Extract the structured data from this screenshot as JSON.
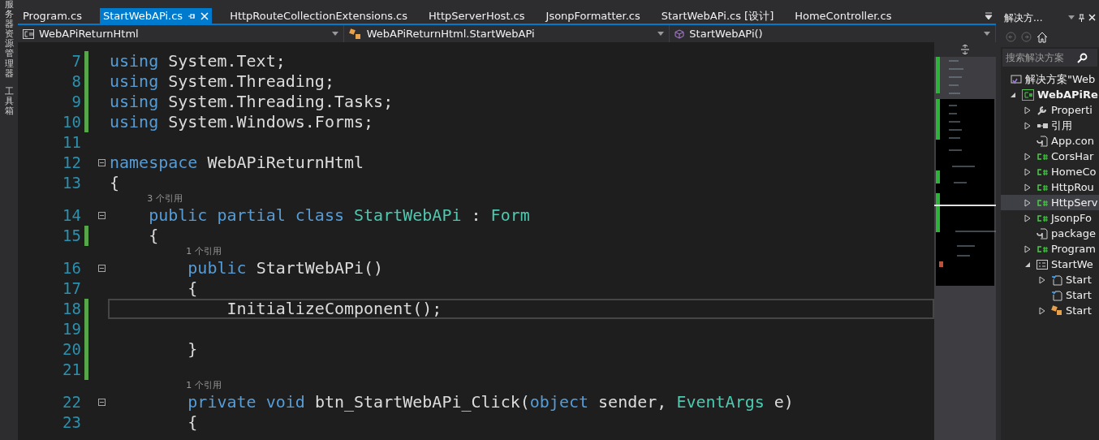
{
  "side_strip": [
    {
      "label": "服务器资源管理器"
    },
    {
      "label": "工具箱"
    }
  ],
  "tabs": [
    {
      "label": "Program.cs",
      "selected": false
    },
    {
      "label": "StartWebAPi.cs",
      "selected": true
    },
    {
      "label": "HttpRouteCollectionExtensions.cs",
      "selected": false
    },
    {
      "label": "HttpServerHost.cs",
      "selected": false
    },
    {
      "label": "JsonpFormatter.cs",
      "selected": false
    },
    {
      "label": "StartWebAPi.cs [设计]",
      "selected": false
    },
    {
      "label": "HomeController.cs",
      "selected": false
    }
  ],
  "nav_bar": [
    {
      "kind": "project",
      "label": "WebAPiReturnHtml"
    },
    {
      "kind": "class",
      "label": "WebAPiReturnHtml.StartWebAPi"
    },
    {
      "kind": "member",
      "label": "StartWebAPi()"
    }
  ],
  "editor": {
    "lines": [
      {
        "kind": "code",
        "number": "7",
        "changed": true,
        "current": false,
        "fold": false,
        "tokens": [
          {
            "kind": "kw",
            "t": "using "
          },
          {
            "kind": "plain",
            "t": "System.Text;"
          }
        ]
      },
      {
        "kind": "code",
        "number": "8",
        "changed": true,
        "current": false,
        "fold": false,
        "tokens": [
          {
            "kind": "kw",
            "t": "using "
          },
          {
            "kind": "plain",
            "t": "System.Threading;"
          }
        ]
      },
      {
        "kind": "code",
        "number": "9",
        "changed": true,
        "current": false,
        "fold": false,
        "tokens": [
          {
            "kind": "kw",
            "t": "using "
          },
          {
            "kind": "plain",
            "t": "System.Threading.Tasks;"
          }
        ]
      },
      {
        "kind": "code",
        "number": "10",
        "changed": true,
        "current": false,
        "fold": false,
        "tokens": [
          {
            "kind": "kw",
            "t": "using "
          },
          {
            "kind": "plain",
            "t": "System.Windows.Forms;"
          }
        ]
      },
      {
        "kind": "code",
        "number": "11",
        "changed": false,
        "current": false,
        "fold": false
      },
      {
        "kind": "code",
        "number": "12",
        "changed": false,
        "current": false,
        "fold": true,
        "tokens": [
          {
            "kind": "kw",
            "t": "namespace "
          },
          {
            "kind": "plain",
            "t": "WebAPiReturnHtml"
          }
        ]
      },
      {
        "kind": "code",
        "number": "13",
        "changed": false,
        "current": false,
        "fold": false,
        "tokens": [
          {
            "kind": "plain",
            "t": "{"
          }
        ]
      },
      {
        "kind": "lens",
        "text": "3 个引用"
      },
      {
        "kind": "code",
        "number": "14",
        "changed": false,
        "current": false,
        "fold": true,
        "tokens": [
          {
            "kind": "kw",
            "t": "    public partial class "
          },
          {
            "kind": "type",
            "t": "StartWebAPi"
          },
          {
            "kind": "plain",
            "t": " : "
          },
          {
            "kind": "type",
            "t": "Form"
          }
        ]
      },
      {
        "kind": "code",
        "number": "15",
        "changed": true,
        "current": false,
        "fold": false,
        "tokens": [
          {
            "kind": "plain",
            "t": "    {"
          }
        ]
      },
      {
        "kind": "lens",
        "text": "1 个引用"
      },
      {
        "kind": "code",
        "number": "16",
        "changed": false,
        "current": false,
        "fold": true,
        "tokens": [
          {
            "kind": "kw",
            "t": "        public "
          },
          {
            "kind": "plain",
            "t": "StartWebAPi()"
          }
        ]
      },
      {
        "kind": "code",
        "number": "17",
        "changed": false,
        "current": false,
        "fold": false,
        "tokens": [
          {
            "kind": "plain",
            "t": "        {"
          }
        ]
      },
      {
        "kind": "code",
        "number": "18",
        "changed": true,
        "current": true,
        "fold": false,
        "tokens": [
          {
            "kind": "plain",
            "t": "            InitializeComponent();"
          }
        ]
      },
      {
        "kind": "code",
        "number": "19",
        "changed": true,
        "current": false,
        "fold": false
      },
      {
        "kind": "code",
        "number": "20",
        "changed": true,
        "current": false,
        "fold": false,
        "tokens": [
          {
            "kind": "plain",
            "t": "        }"
          }
        ]
      },
      {
        "kind": "code",
        "number": "21",
        "changed": true,
        "current": false,
        "fold": false
      },
      {
        "kind": "lens",
        "text": "1 个引用"
      },
      {
        "kind": "code",
        "number": "22",
        "changed": false,
        "current": false,
        "fold": true,
        "tokens": [
          {
            "kind": "kw",
            "t": "        private void "
          },
          {
            "kind": "plain",
            "t": "btn_StartWebAPi_Click("
          },
          {
            "kind": "kw",
            "t": "object "
          },
          {
            "kind": "plain",
            "t": "sender, "
          },
          {
            "kind": "type",
            "t": "EventArgs "
          },
          {
            "kind": "plain",
            "t": "e)"
          }
        ]
      },
      {
        "kind": "code",
        "number": "23",
        "changed": false,
        "current": false,
        "fold": false,
        "tokens": [
          {
            "kind": "plain",
            "t": "        {"
          }
        ]
      }
    ]
  },
  "solution_explorer": {
    "title": "解决方...",
    "search": {
      "placeholder": "搜索解决方案"
    },
    "tree": [
      {
        "kind": "solution",
        "label": "解决方案\"Web",
        "selected": false,
        "children": [
          {
            "kind": "csproject",
            "label": "WebAPiRe",
            "expanded": true,
            "selected": false,
            "children": [
              {
                "kind": "wrench",
                "label": "Properti",
                "expanded": false,
                "selected": false
              },
              {
                "kind": "references",
                "label": "引用",
                "expanded": false,
                "selected": false
              },
              {
                "kind": "config",
                "label": "App.con",
                "selected": false
              },
              {
                "kind": "cs",
                "label": "CorsHar",
                "expanded": false,
                "selected": false
              },
              {
                "kind": "cs",
                "label": "HomeCo",
                "expanded": false,
                "selected": false
              },
              {
                "kind": "cs",
                "label": "HttpRou",
                "expanded": false,
                "selected": false
              },
              {
                "kind": "cs",
                "label": "HttpServ",
                "expanded": false,
                "selected": true
              },
              {
                "kind": "cs",
                "label": "JsonpFo",
                "expanded": false,
                "selected": false
              },
              {
                "kind": "config",
                "label": "package",
                "selected": false
              },
              {
                "kind": "cs",
                "label": "Program",
                "expanded": false,
                "selected": false
              },
              {
                "kind": "form",
                "label": "StartWe",
                "expanded": true,
                "selected": false,
                "children": [
                  {
                    "kind": "designer",
                    "label": "Start",
                    "expanded": false,
                    "selected": false
                  },
                  {
                    "kind": "designer",
                    "label": "Start",
                    "selected": false
                  },
                  {
                    "kind": "class",
                    "label": "Start",
                    "expanded": false,
                    "selected": false
                  }
                ]
              }
            ]
          }
        ]
      }
    ]
  }
}
